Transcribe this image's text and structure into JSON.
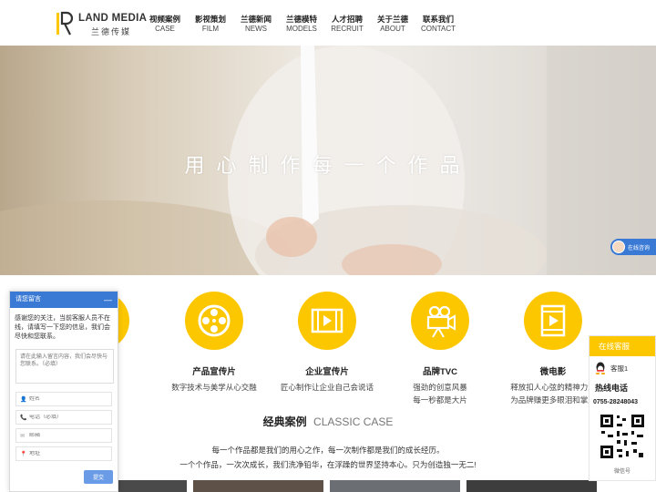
{
  "header": {
    "logo_en": "LAND MEDIA",
    "logo_cn": "兰德传媒",
    "nav": [
      {
        "cn": "视频案例",
        "en": "CASE"
      },
      {
        "cn": "影视策划",
        "en": "FILM"
      },
      {
        "cn": "兰德新闻",
        "en": "NEWS"
      },
      {
        "cn": "兰德模特",
        "en": "MODELS"
      },
      {
        "cn": "人才招聘",
        "en": "RECRUIT"
      },
      {
        "cn": "关于兰德",
        "en": "ABOUT"
      },
      {
        "cn": "联系我们",
        "en": "CONTACT"
      }
    ]
  },
  "banner": {
    "slogan": "用心制作每一个作品"
  },
  "chat_tab": {
    "label": "在线咨询"
  },
  "services": [
    {
      "title": "",
      "desc1": "",
      "desc2": ""
    },
    {
      "title": "产品宣传片",
      "desc1": "数字技术与美学从心交融",
      "desc2": ""
    },
    {
      "title": "企业宣传片",
      "desc1": "匠心制作让企业自己会说话",
      "desc2": ""
    },
    {
      "title": "品牌TVC",
      "desc1": "强劲的创意风暴",
      "desc2": "每一秒都是大片"
    },
    {
      "title": "微电影",
      "desc1": "释放扣人心弦的精神力量",
      "desc2": "为品牌赚更多眼泪和掌声"
    }
  ],
  "classic": {
    "title_cn": "经典案例",
    "title_en": "CLASSIC CASE",
    "desc1": "每一个作品都是我们的用心之作，每一次制作都是我们的成长经历。",
    "desc2": "一个个作品，一次次成长，我们洗净铅华，在浮躁的世界坚持本心。只为创造独一无二!"
  },
  "message_panel": {
    "title": "请您留言",
    "minimize": "—",
    "intro": "感谢您的关注，当前客服人员不在线，请填写一下您的信息，我们会尽快和您联系。",
    "textarea_placeholder": "请在此输入留言内容，我们会尽快与您联系。（必填）",
    "fields": [
      {
        "icon": "👤",
        "placeholder": "姓名"
      },
      {
        "icon": "📞",
        "placeholder": "电话（必填）"
      },
      {
        "icon": "✉",
        "placeholder": "邮箱"
      },
      {
        "icon": "📍",
        "placeholder": "地址"
      }
    ],
    "submit": "提交"
  },
  "cs_panel": {
    "title": "在线客服",
    "qq_label": "客服1",
    "hotline_title": "热线电话",
    "phone": "0755-28248043",
    "qr_label": "微信号"
  },
  "colors": {
    "accent_yellow": "#fdc700",
    "chat_blue": "#3a7ad5"
  }
}
